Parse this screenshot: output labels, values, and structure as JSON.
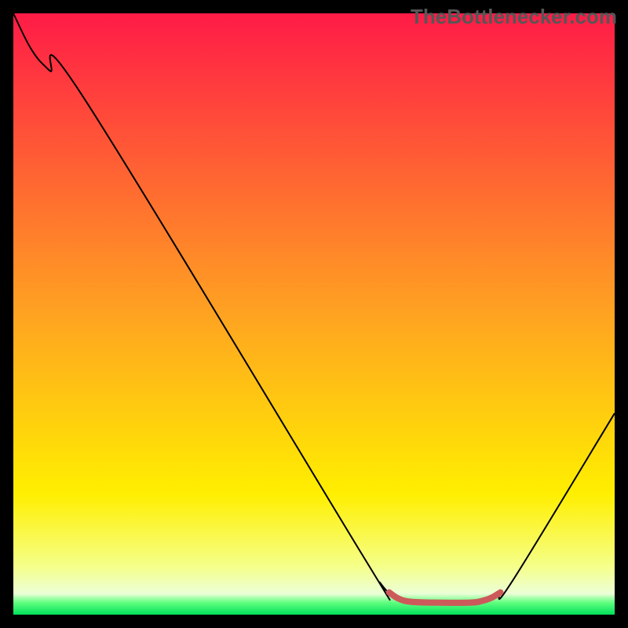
{
  "watermark": "TheBottlenecker.com",
  "chart_data": {
    "type": "line",
    "title": "",
    "xlabel": "",
    "ylabel": "",
    "xlim": [
      0,
      100
    ],
    "ylim": [
      0,
      100
    ],
    "gradient_stops": [
      {
        "offset": 0,
        "color": "#ff1b47"
      },
      {
        "offset": 0.5,
        "color": "#ffa321"
      },
      {
        "offset": 0.8,
        "color": "#ffef00"
      },
      {
        "offset": 0.92,
        "color": "#f5ff8a"
      },
      {
        "offset": 0.965,
        "color": "#ecffd7"
      },
      {
        "offset": 0.98,
        "color": "#5fff7f"
      },
      {
        "offset": 1.0,
        "color": "#00e05a"
      }
    ],
    "series": [
      {
        "name": "main-curve",
        "color": "#000000",
        "width": 2,
        "points": [
          {
            "x": 0.0,
            "y": 100.0
          },
          {
            "x": 3.0,
            "y": 94.0
          },
          {
            "x": 6.0,
            "y": 90.5
          },
          {
            "x": 12.0,
            "y": 85.5
          },
          {
            "x": 58.0,
            "y": 10.0
          },
          {
            "x": 61.0,
            "y": 5.3
          },
          {
            "x": 63.0,
            "y": 3.2
          },
          {
            "x": 65.0,
            "y": 2.3
          },
          {
            "x": 70.0,
            "y": 2.0
          },
          {
            "x": 76.0,
            "y": 2.0
          },
          {
            "x": 78.0,
            "y": 2.3
          },
          {
            "x": 80.5,
            "y": 3.3
          },
          {
            "x": 83.0,
            "y": 5.6
          },
          {
            "x": 100.0,
            "y": 33.5
          }
        ]
      },
      {
        "name": "sweet-spot-marker",
        "color": "#cc5a5a",
        "width": 8,
        "points": [
          {
            "x": 62.5,
            "y": 3.7
          },
          {
            "x": 64.0,
            "y": 2.7
          },
          {
            "x": 66.0,
            "y": 2.15
          },
          {
            "x": 70.0,
            "y": 2.0
          },
          {
            "x": 76.0,
            "y": 2.0
          },
          {
            "x": 78.0,
            "y": 2.3
          },
          {
            "x": 79.5,
            "y": 2.8
          },
          {
            "x": 81.0,
            "y": 3.7
          }
        ]
      }
    ]
  }
}
